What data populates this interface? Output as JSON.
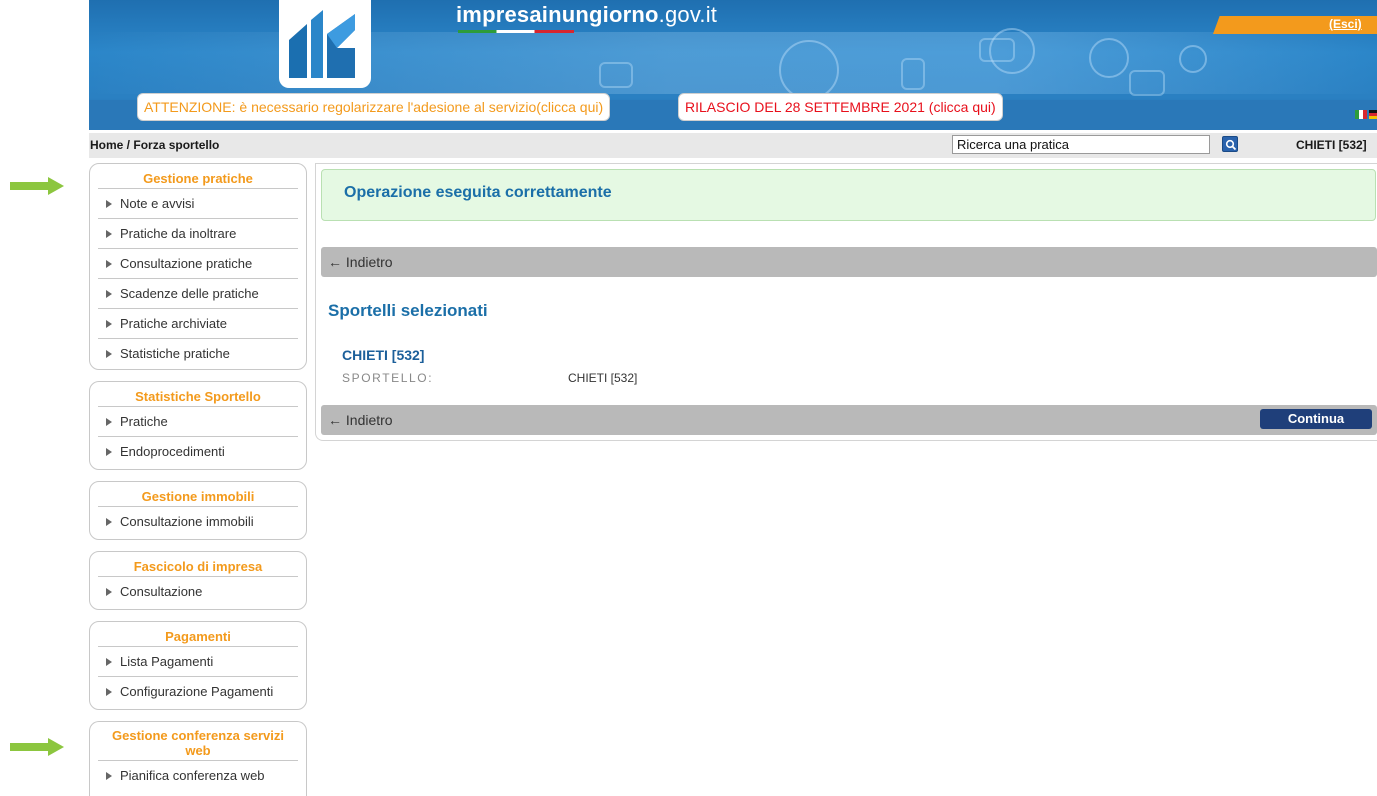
{
  "header": {
    "site_title_bold": "impresainungiorno",
    "site_title_rest": ".gov.it",
    "logout_label": "(Esci)",
    "alert_regolarizzare": "ATTENZIONE: è necessario regolarizzare l'adesione al servizio(clicca qui)",
    "alert_rilascio": "RILASCIO DEL 28 SETTEMBRE 2021 (clicca qui)",
    "colors": {
      "header_blue": "#2b86c9",
      "accent_orange": "#f39a1c",
      "alert_red": "#e8101c"
    }
  },
  "breadcrumb": {
    "home": "Home",
    "separator": " / ",
    "current": "Forza sportello"
  },
  "search": {
    "value": "Ricerca una pratica"
  },
  "user_sportello": "CHIETI [532]",
  "sidebar": {
    "sections": [
      {
        "title": "Gestione pratiche",
        "items": [
          "Note e avvisi",
          "Pratiche da inoltrare",
          "Consultazione pratiche",
          "Scadenze delle pratiche",
          "Pratiche archiviate",
          "Statistiche pratiche"
        ]
      },
      {
        "title": "Statistiche Sportello",
        "items": [
          "Pratiche",
          "Endoprocedimenti"
        ]
      },
      {
        "title": "Gestione immobili",
        "items": [
          "Consultazione immobili"
        ]
      },
      {
        "title": "Fascicolo di impresa",
        "items": [
          "Consultazione"
        ]
      },
      {
        "title": "Pagamenti",
        "items": [
          "Lista Pagamenti",
          "Configurazione Pagamenti"
        ]
      },
      {
        "title": "Gestione conferenza servizi web",
        "items": [
          "Pianifica conferenza web"
        ]
      }
    ]
  },
  "main": {
    "success_message": "Operazione eseguita correttamente",
    "back_label": "← Indietro",
    "section_title": "Sportelli selezionati",
    "sportello_name": "CHIETI [532]",
    "sportello_label": "SPORTELLO:",
    "sportello_value": "CHIETI [532]",
    "continue_label": "Continua"
  }
}
